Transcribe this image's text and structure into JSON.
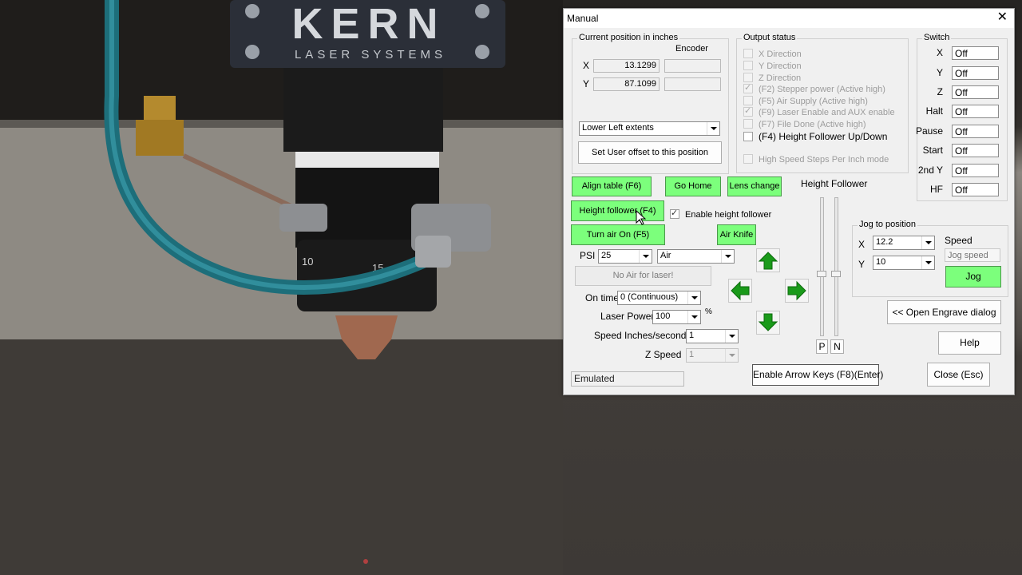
{
  "background": {
    "brand": "KERN",
    "brand_sub": "LASER SYSTEMS",
    "scale_marks": [
      "10",
      "15"
    ]
  },
  "dialog": {
    "title": "Manual",
    "close_icon": "close-icon",
    "position_group": {
      "label": "Current position in inches",
      "encoder_label": "Encoder",
      "x_label": "X",
      "y_label": "Y",
      "x_value": "13.1299",
      "y_value": "87.1099",
      "x_encoder": "",
      "y_encoder": "",
      "extents_selected": "Lower Left extents",
      "set_offset_label": "Set User offset to this position"
    },
    "output_group": {
      "label": "Output status",
      "items": [
        {
          "label": "X Direction",
          "checked": false,
          "enabled": false
        },
        {
          "label": "Y Direction",
          "checked": false,
          "enabled": false
        },
        {
          "label": "Z Direction",
          "checked": false,
          "enabled": false
        },
        {
          "label": "(F2) Stepper power (Active high)",
          "checked": true,
          "enabled": false
        },
        {
          "label": "(F5) Air Supply (Active high)",
          "checked": false,
          "enabled": false
        },
        {
          "label": "(F9) Laser Enable and AUX enable",
          "checked": true,
          "enabled": false
        },
        {
          "label": "(F7) File Done (Active high)",
          "checked": false,
          "enabled": false
        },
        {
          "label": "(F4) Height Follower Up/Down",
          "checked": false,
          "enabled": true
        }
      ],
      "high_speed_label": "High Speed Steps Per Inch mode"
    },
    "switch_group": {
      "label": "Switch",
      "items": [
        {
          "label": "X",
          "value": "Off"
        },
        {
          "label": "Y",
          "value": "Off"
        },
        {
          "label": "Z",
          "value": "Off"
        },
        {
          "label": "Halt",
          "value": "Off"
        },
        {
          "label": "Pause",
          "value": "Off"
        },
        {
          "label": "Start",
          "value": "Off"
        },
        {
          "label": "2nd Y",
          "value": "Off"
        },
        {
          "label": "HF",
          "value": "Off"
        }
      ]
    },
    "buttons": {
      "align_table": "Align table (F6)",
      "go_home": "Go Home",
      "lens_change": "Lens change",
      "height_follower": "Height follower (F4)",
      "turn_air_on": "Turn air On (F5)",
      "air_knife": "Air Knife",
      "no_air": "No Air for laser!",
      "open_engrave": "<< Open Engrave dialog",
      "help": "Help",
      "enable_arrow_keys": "Enable Arrow Keys (F8)(Enter)",
      "close": "Close (Esc)",
      "jog": "Jog",
      "p": "P",
      "n": "N"
    },
    "enable_height_follower": {
      "label": "Enable height follower",
      "checked": true
    },
    "height_follower_label": "Height Follower",
    "psi": {
      "label": "PSI",
      "value": "25",
      "gas": "Air"
    },
    "on_time": {
      "label": "On time",
      "value": "0 (Continuous)"
    },
    "laser_power": {
      "label": "Laser Power",
      "value": "100",
      "unit": "%"
    },
    "speed": {
      "label": "Speed Inches/second",
      "value": "1"
    },
    "z_speed": {
      "label": "Z Speed",
      "value": "1"
    },
    "status_text": "Emulated",
    "jog_group": {
      "label": "Jog to position",
      "x_label": "X",
      "y_label": "Y",
      "x_value": "12.2",
      "y_value": "10",
      "speed_label": "Speed",
      "speed_placeholder": "Jog speed"
    },
    "colors": {
      "green_button": "#7cff7c",
      "arrow_green": "#1a9a1a"
    }
  }
}
